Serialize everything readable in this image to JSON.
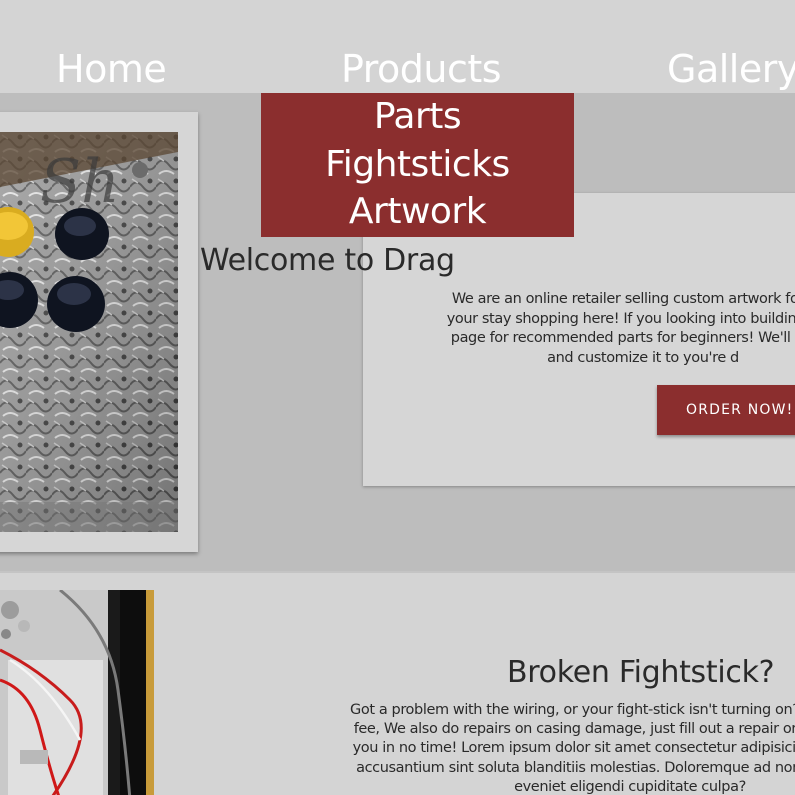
{
  "nav": {
    "items": [
      {
        "label": "Home"
      },
      {
        "label": "Products"
      },
      {
        "label": "Gallery"
      }
    ]
  },
  "dropdown": {
    "items": [
      {
        "label": "Parts"
      },
      {
        "label": "Fightsticks"
      },
      {
        "label": "Artwork"
      }
    ]
  },
  "hero": {
    "title": "Welcome to Drag",
    "text_lines": [
      "We are an online retailer selling custom artwork for figh",
      "your stay shopping here! If you looking into building a ne",
      "page for recommended parts for beginners! We'll also e",
      "and customize it to you're d"
    ],
    "order_button": "ORDER NOW!"
  },
  "repair": {
    "title": "Broken Fightstick?",
    "text_lines": [
      "Got a problem with the wiring, or your fight-stick isn't turning on? Send in the stic",
      "fee, We also do repairs on casing damage, just fill out a repair order and we'll ha",
      "you in no time! Lorem ipsum dolor sit amet consectetur adipisicing elit. Magnam",
      "accusantium sint soluta blanditiis molestias. Doloremque ad non necessitatibus",
      "eveniet eligendi cupiditate culpa?"
    ]
  },
  "colors": {
    "accent": "#8b2e2e",
    "page_bg": "#d4d4d4",
    "hero_bg": "#bdbdbd",
    "text": "#2a2a2a"
  }
}
